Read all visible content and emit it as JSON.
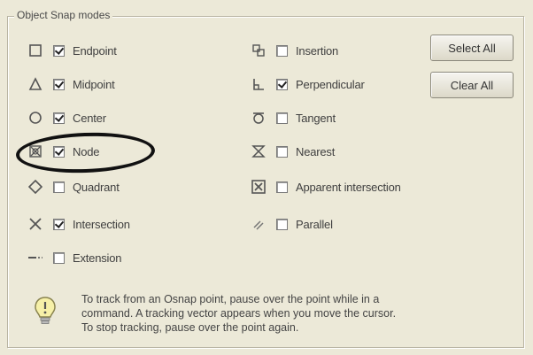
{
  "group_title": "Object Snap modes",
  "left_column": [
    {
      "icon": "square-icon",
      "label": "Endpoint",
      "checked": true
    },
    {
      "icon": "triangle-icon",
      "label": "Midpoint",
      "checked": true
    },
    {
      "icon": "circle-icon",
      "label": "Center",
      "checked": true
    },
    {
      "icon": "node-icon",
      "label": "Node",
      "checked": true
    },
    {
      "icon": "diamond-icon",
      "label": "Quadrant",
      "checked": false
    },
    {
      "icon": "x-icon",
      "label": "Intersection",
      "checked": true
    },
    {
      "icon": "extension-icon",
      "label": "Extension",
      "checked": false
    }
  ],
  "right_column": [
    {
      "icon": "insertion-icon",
      "label": "Insertion",
      "checked": false
    },
    {
      "icon": "perpendicular-icon",
      "label": "Perpendicular",
      "checked": true
    },
    {
      "icon": "tangent-icon",
      "label": "Tangent",
      "checked": false
    },
    {
      "icon": "nearest-icon",
      "label": "Nearest",
      "checked": false
    },
    {
      "icon": "apparent-intersection-icon",
      "label": "Apparent intersection",
      "checked": false
    },
    {
      "icon": "parallel-icon",
      "label": "Parallel",
      "checked": false
    }
  ],
  "buttons": {
    "select_all": "Select All",
    "clear_all": "Clear All"
  },
  "note": {
    "line1": "To track from an Osnap point, pause over the point while in a",
    "line2": "command.  A tracking vector appears when you move the cursor.",
    "line3": "To stop tracking, pause over the point again."
  }
}
